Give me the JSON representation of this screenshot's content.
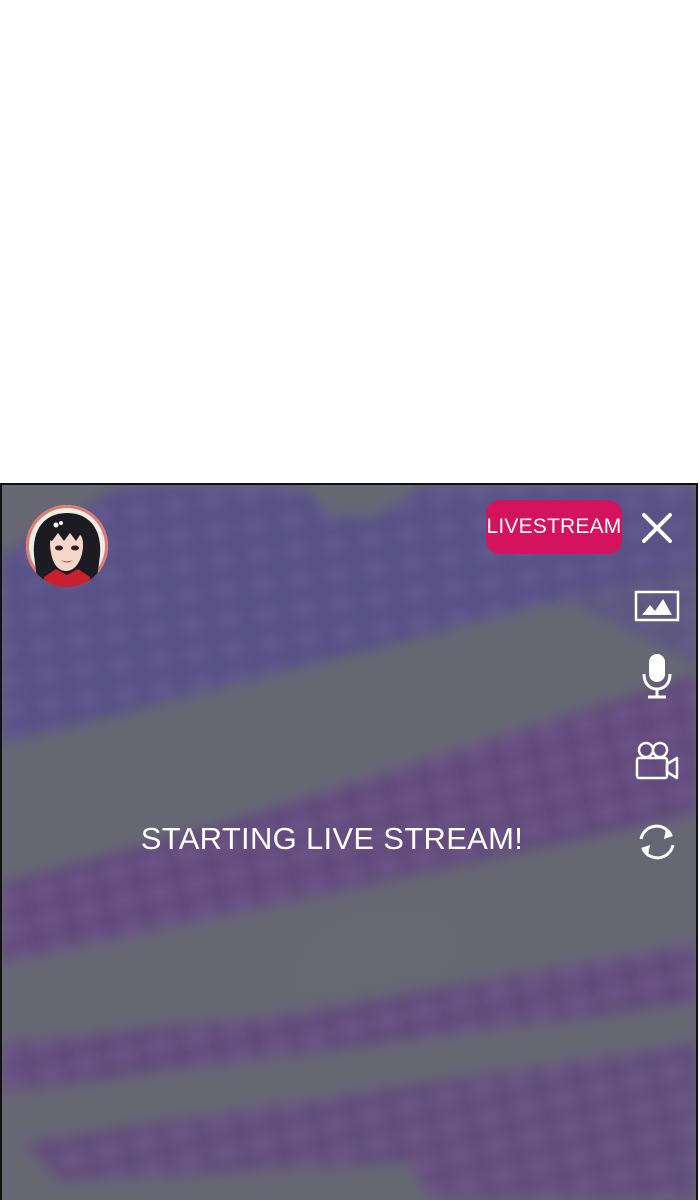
{
  "stream": {
    "badge_label": "LIVESTREAM",
    "status_message": "STARTING LIVE STREAM!"
  },
  "controls": [
    {
      "name": "close-icon",
      "action": "close"
    },
    {
      "name": "image-icon",
      "action": "gallery"
    },
    {
      "name": "microphone-icon",
      "action": "microphone"
    },
    {
      "name": "video-camera-icon",
      "action": "camera"
    },
    {
      "name": "refresh-icon",
      "action": "switch-camera"
    }
  ],
  "colors": {
    "badge": "#d3135e",
    "overlay": "#676774",
    "pattern": "#5a4a8c",
    "icon": "#ffffff"
  }
}
